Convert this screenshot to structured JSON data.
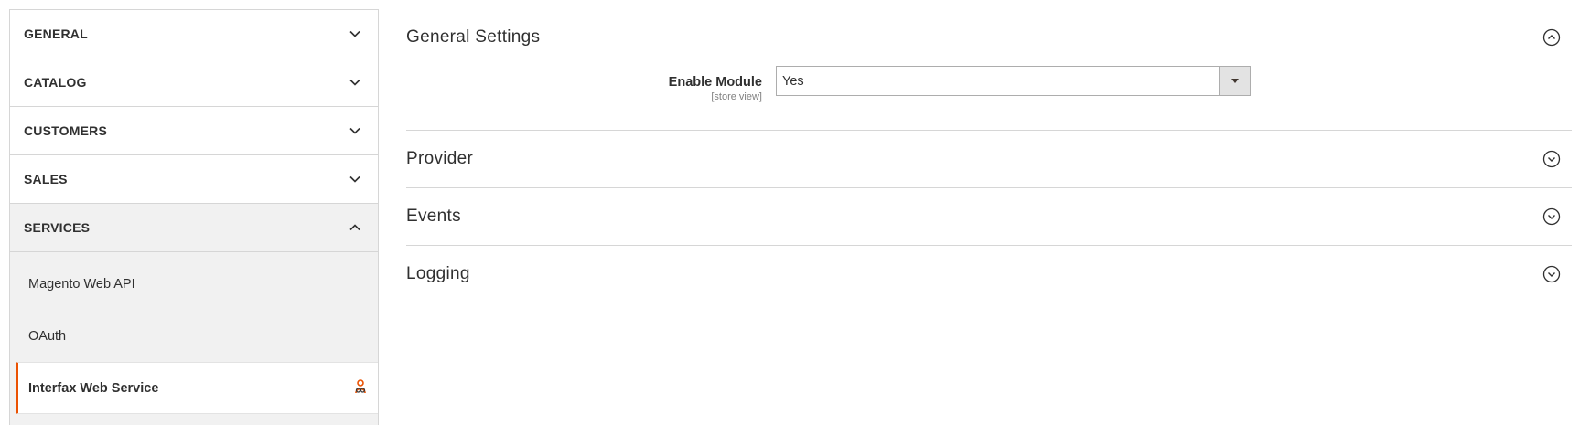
{
  "sidebar": {
    "sections": [
      {
        "title": "GENERAL",
        "state": "collapsed"
      },
      {
        "title": "CATALOG",
        "state": "collapsed"
      },
      {
        "title": "CUSTOMERS",
        "state": "collapsed"
      },
      {
        "title": "SALES",
        "state": "collapsed"
      },
      {
        "title": "SERVICES",
        "state": "expanded"
      }
    ],
    "services_items": [
      {
        "label": "Magento Web API"
      },
      {
        "label": "OAuth"
      },
      {
        "label": "Interfax Web Service",
        "active": true
      }
    ],
    "active_accent_color": "#eb5202",
    "active_item_icon": "interfax-logo-icon"
  },
  "main": {
    "groups": [
      {
        "title": "General Settings",
        "state": "expanded"
      },
      {
        "title": "Provider",
        "state": "collapsed"
      },
      {
        "title": "Events",
        "state": "collapsed"
      },
      {
        "title": "Logging",
        "state": "collapsed"
      }
    ],
    "enable_module": {
      "label": "Enable Module",
      "scope": "[store view]",
      "value": "Yes"
    }
  }
}
